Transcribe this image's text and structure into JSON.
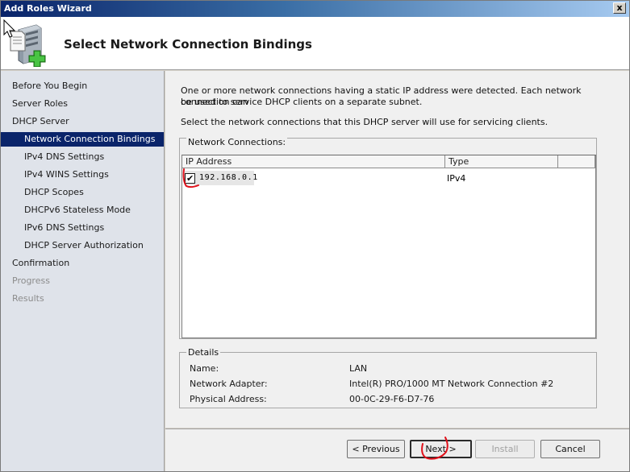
{
  "window": {
    "title": "Add Roles Wizard",
    "close_glyph": "x"
  },
  "header": {
    "title": "Select Network Connection Bindings",
    "icon": "server-add-role-icon"
  },
  "nav": {
    "items": [
      {
        "label": "Before You Begin"
      },
      {
        "label": "Server Roles"
      },
      {
        "label": "DHCP Server"
      },
      {
        "label": "Network Connection Bindings"
      },
      {
        "label": "IPv4 DNS Settings"
      },
      {
        "label": "IPv4 WINS Settings"
      },
      {
        "label": "DHCP Scopes"
      },
      {
        "label": "DHCPv6 Stateless Mode"
      },
      {
        "label": "IPv6 DNS Settings"
      },
      {
        "label": "DHCP Server Authorization"
      },
      {
        "label": "Confirmation"
      },
      {
        "label": "Progress"
      },
      {
        "label": "Results"
      }
    ]
  },
  "content": {
    "intro_line1": "One or more network connections having a static IP address were detected. Each network connection can",
    "intro_line2": "be used to service DHCP clients on a separate subnet.",
    "instruction": "Select the network connections that this DHCP server will use for servicing clients.",
    "connections_label": "Network Connections:",
    "columns": [
      "IP Address",
      "Type"
    ],
    "rows": [
      {
        "ip": "192.168.0.1",
        "type": "IPv4",
        "checked": true
      }
    ],
    "details_label": "Details",
    "details": [
      {
        "key": "Name:",
        "value": "LAN"
      },
      {
        "key": "Network Adapter:",
        "value": "Intel(R) PRO/1000 MT Network Connection #2"
      },
      {
        "key": "Physical Address:",
        "value": "00-0C-29-F6-D7-76"
      }
    ]
  },
  "buttons": {
    "previous": "< Previous",
    "next": "Next >",
    "install": "Install",
    "cancel": "Cancel"
  },
  "colors": {
    "selected_nav": "#0a246a",
    "annotation": "#e0101a"
  }
}
